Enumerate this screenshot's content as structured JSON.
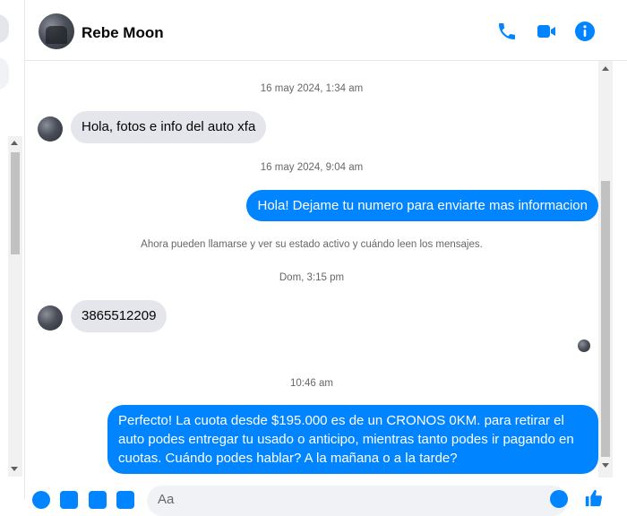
{
  "header": {
    "contact_name": "Rebe Moon",
    "icons": [
      "phone-icon",
      "video-icon",
      "info-icon"
    ]
  },
  "colors": {
    "accent": "#0084ff",
    "incoming_bubble": "#e4e6eb",
    "muted_text": "#65676b"
  },
  "conversation": {
    "timestamp_1": "16 may 2024, 1:34 am",
    "message_in_1": "Hola, fotos e info del auto xfa",
    "timestamp_2": "16 may 2024, 9:04 am",
    "message_out_1": "Hola! Dejame tu numero para enviarte mas informacion",
    "notice": "Ahora pueden llamarse y ver su estado activo y cuándo leen los mensajes.",
    "timestamp_3": "Dom, 3:15 pm",
    "message_in_2": "3865512209",
    "timestamp_4": "10:46 am",
    "message_out_2": "Perfecto! La cuota desde $195.000 es de un CRONOS 0KM. para retirar el auto podes entregar tu usado o anticipo, mientras tanto podes ir pagando en cuotas. Cuándo podes hablar? A la mañana o a la tarde?"
  },
  "composer": {
    "placeholder": "Aa"
  }
}
